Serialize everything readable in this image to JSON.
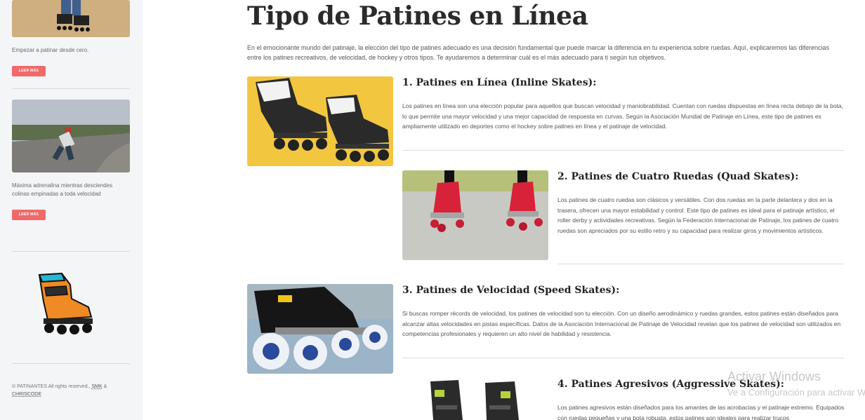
{
  "sidebar": {
    "cards": [
      {
        "text": "Empezar a patinar desde cero.",
        "button": "LEER MÁS"
      },
      {
        "text": "Máxima adrenalina mientras desciendes colinas empinadas a toda velocidad",
        "button": "LEER MÁS"
      }
    ],
    "footer": {
      "prefix": "© PATINANTES All rights reserved.,",
      "link1": "SMK",
      "amp": "&",
      "link2": "CHRISCODE"
    }
  },
  "article": {
    "title": "Tipo de Patines en Línea",
    "intro": "En el emocionante mundo del patinaje, la elección del tipo de patines adecuado es una decisión fundamental que puede marcar la diferencia en tu experiencia sobre ruedas. Aquí, explicaremos las diferencias entre los patines recreativos, de velocidad, de hockey y otros tipos. Te ayudaremos a determinar cuál es el más adecuado para ti según tus objetivos.",
    "sections": [
      {
        "heading": "1. Patines en Línea (Inline Skates):",
        "body": "Los patines en línea son una elección popular para aquellos que buscan velocidad y maniobrabilidad. Cuentan con ruedas dispuestas en línea recta debajo de la bota, lo que permite una mayor velocidad y una mejor capacidad de respuesta en curvas. Según la Asociación Mundial de Patinaje en Línea, este tipo de patines es ampliamente utilizado en deportes como el hockey sobre patines en línea y el patinaje de velocidad."
      },
      {
        "heading": "2. Patines de Cuatro Ruedas (Quad Skates):",
        "body": "Los patines de cuatro ruedas son clásicos y versátiles. Con dos ruedas en la parte delantera y dos en la trasera, ofrecen una mayor estabilidad y control. Este tipo de patines es ideal para el patinaje artístico, el roller derby y actividades recreativas. Según la Federación Internacional de Patinaje, los patines de cuatro ruedas son apreciados por su estilo retro y su capacidad para realizar giros y movimientos artísticos."
      },
      {
        "heading": "3. Patines de Velocidad (Speed Skates):",
        "body": "Si buscas romper récords de velocidad, los patines de velocidad son tu elección. Con un diseño aerodinámico y ruedas grandes, estos patines están diseñados para alcanzar altas velocidades en pistas específicas. Datos de la Asociación Internacional de Patinaje de Velocidad revelan que los patines de velocidad son utilizados en competencias profesionales y requieren un alto nivel de habilidad y resistencia."
      },
      {
        "heading": "4. Patines Agresivos (Aggressive Skates):",
        "body": "Los patines agresivos están diseñados para los amantes de las acrobacias y el patinaje extremo. Equipados con ruedas pequeñas y una bota robusta, estos patines son ideales para realizar trucos"
      }
    ]
  },
  "watermark": {
    "line1": "Activar Windows",
    "line2": "Ve a Configuración para activar Windows."
  }
}
